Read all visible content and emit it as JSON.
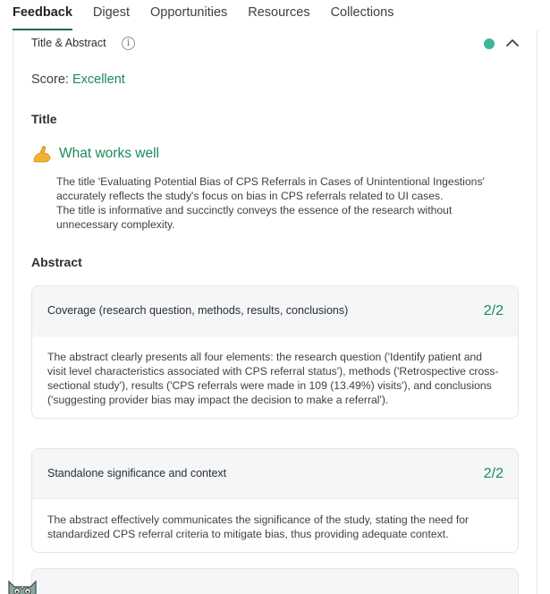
{
  "tabs": [
    {
      "label": "Feedback",
      "active": true
    },
    {
      "label": "Digest"
    },
    {
      "label": "Opportunities"
    },
    {
      "label": "Resources"
    },
    {
      "label": "Collections"
    }
  ],
  "panel": {
    "title": "Title & Abstract",
    "info_icon": "i",
    "status_color": "#3db79b"
  },
  "score": {
    "label": "Score:",
    "value": "Excellent"
  },
  "title_section": {
    "heading": "Title",
    "works_well": {
      "icon": "flexed-biceps-icon",
      "heading": "What works well",
      "lines": [
        "The title 'Evaluating Potential Bias of CPS Referrals in Cases of Unintentional Ingestions' accurately reflects the study's focus on bias in CPS referrals related to UI cases.",
        "The title is informative and succinctly conveys the essence of the research without unnecessary complexity."
      ]
    }
  },
  "abstract_section": {
    "heading": "Abstract",
    "cards": [
      {
        "title": "Coverage (research question, methods, results, conclusions)",
        "score": "2/2",
        "body": "The abstract clearly presents all four elements: the research question ('Identify patient and visit level characteristics associated with CPS referral status'), methods ('Retrospective cross-sectional study'), results ('CPS referrals were made in 109 (13.49%) visits'), and conclusions ('suggesting provider bias may impact the decision to make a referral')."
      },
      {
        "title": "Standalone significance and context",
        "score": "2/2",
        "body": "The abstract effectively communicates the significance of the study, stating the need for standardized CPS referral criteria to mitigate bias, thus providing adequate context."
      }
    ]
  },
  "colors": {
    "accent": "#1b8a5a",
    "tab_underline": "#1b6b4f"
  }
}
